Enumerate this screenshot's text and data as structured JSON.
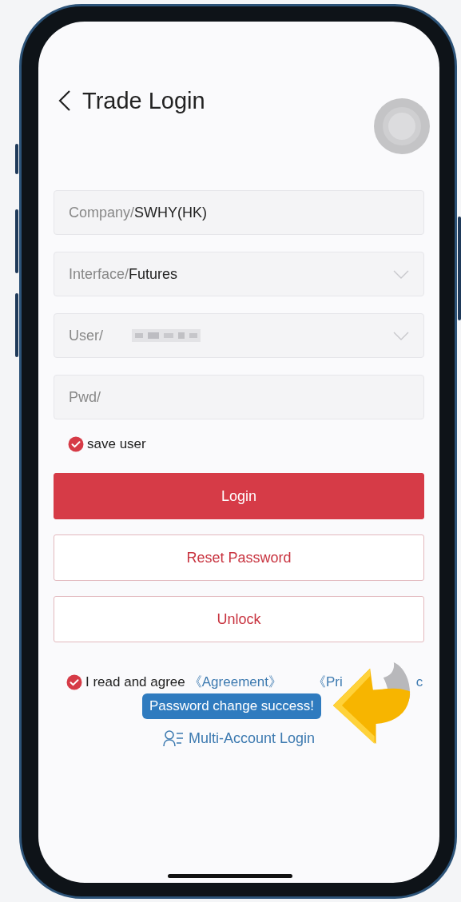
{
  "header": {
    "title": "Trade Login"
  },
  "fields": [
    {
      "kind": "text",
      "label": "Company/",
      "value": "SWHY(HK)",
      "masked": false
    },
    {
      "kind": "select",
      "label": "Interface/",
      "value": "Futures",
      "masked": false
    },
    {
      "kind": "select",
      "label": "User/",
      "masked": true
    },
    {
      "kind": "password",
      "label": "Pwd/",
      "masked": false
    }
  ],
  "save_user": {
    "label": "save user",
    "checked": true
  },
  "buttons": [
    {
      "kind": "primary",
      "label": "Login"
    },
    {
      "kind": "outline",
      "label": "Reset Password"
    },
    {
      "kind": "outline",
      "label": "Unlock"
    }
  ],
  "agreement": {
    "checked": true,
    "text": "I read and agree",
    "links": [
      "《Agreement》",
      "《Pri",
      "c"
    ]
  },
  "toast": "Password change success!",
  "multi_account": {
    "label": "Multi-Account Login"
  }
}
